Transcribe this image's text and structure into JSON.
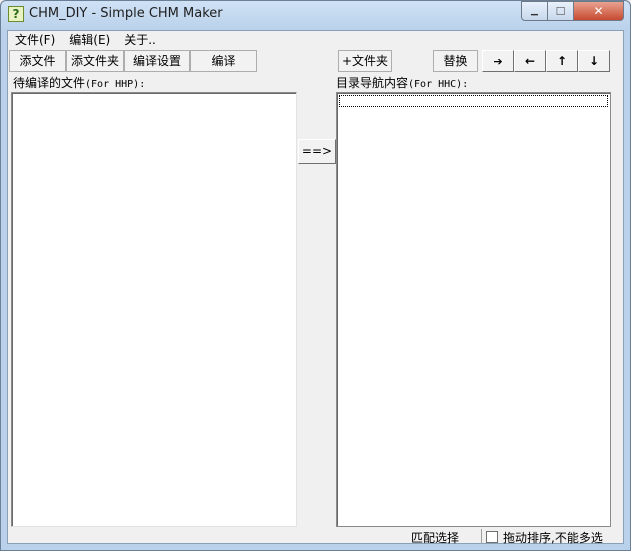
{
  "window": {
    "title": "CHM_DIY - Simple CHM Maker",
    "icon": "app-help-icon",
    "icon_glyph": "?",
    "min_glyph": "▁",
    "max_glyph": "☐",
    "close_glyph": "✕"
  },
  "menu": [
    "文件(F)",
    "编辑(E)",
    "关于.."
  ],
  "toolbar_left": [
    "添文件",
    "添文件夹",
    "编译设置",
    "编译"
  ],
  "toolbar_right": {
    "add_folder": "+文件夹",
    "replace": "替换",
    "arrow_right": "➔",
    "arrow_left": "←",
    "arrow_up": "↑",
    "arrow_down": "↓"
  },
  "left_panel": {
    "label_cn": "待编译的文件",
    "label_en": "(For HHP):"
  },
  "right_panel": {
    "label_cn": "目录导航内容",
    "label_en": "(For HHC):"
  },
  "transfer_button": "==>",
  "status": {
    "match_select": "匹配选择",
    "drag_sort": "拖动排序,不能多选",
    "drag_sort_checked": false
  }
}
